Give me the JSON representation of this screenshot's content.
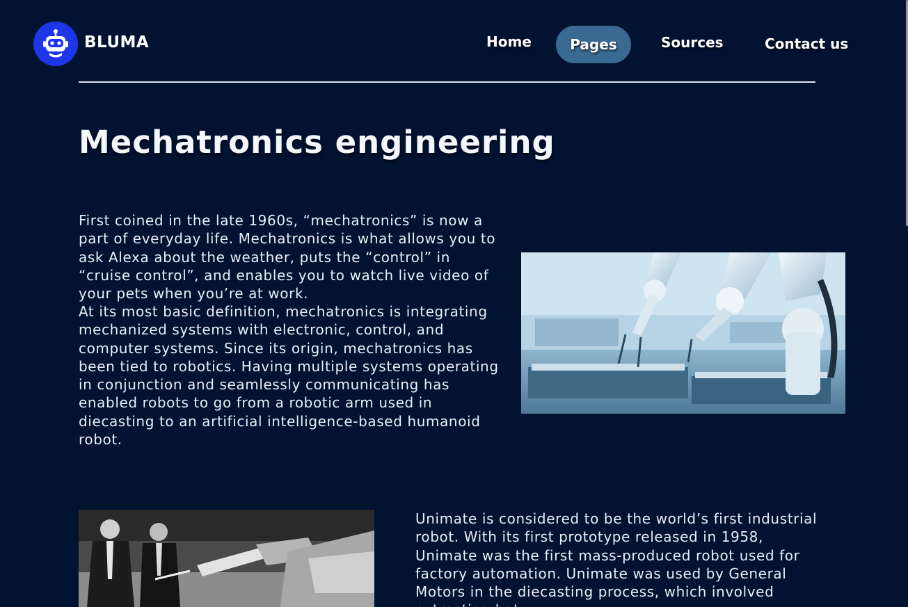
{
  "header": {
    "brand": "BLUMA",
    "logo_icon": "robot-head-icon",
    "nav": {
      "home": "Home",
      "pages": "Pages",
      "sources": "Sources",
      "contact": "Contact us"
    },
    "active_nav": "Pages"
  },
  "main": {
    "title": "Mechatronics engineering",
    "paragraph_1": "First coined in the late 1960s, “mechatronics” is now a part of everyday life. Mechatronics is what allows you to ask Alexa about the weather, puts the “control” in “cruise control”, and enables you to watch live video of your pets when you’re at work.",
    "paragraph_2": "At its most basic definition, mechatronics is integrating mechanized systems with electronic, control, and computer systems. Since its origin, mechatronics has been tied to robotics. Having multiple systems operating in conjunction and seamlessly communicating has enabled robots to go from a robotic arm used in diecasting to an artificial intelligence-based humanoid robot.",
    "paragraph_3": "Unimate is considered to be the world’s first industrial robot. With its first prototype released in 1958, Unimate was the first mass-produced robot used for factory automation. Unimate was used by General Motors in the diecasting process, which involved extracting hot"
  },
  "colors": {
    "background": "#021332",
    "logo_circle": "#1d36e8",
    "active_nav_pill": "#3a6a91",
    "text": "#e8eef6"
  }
}
